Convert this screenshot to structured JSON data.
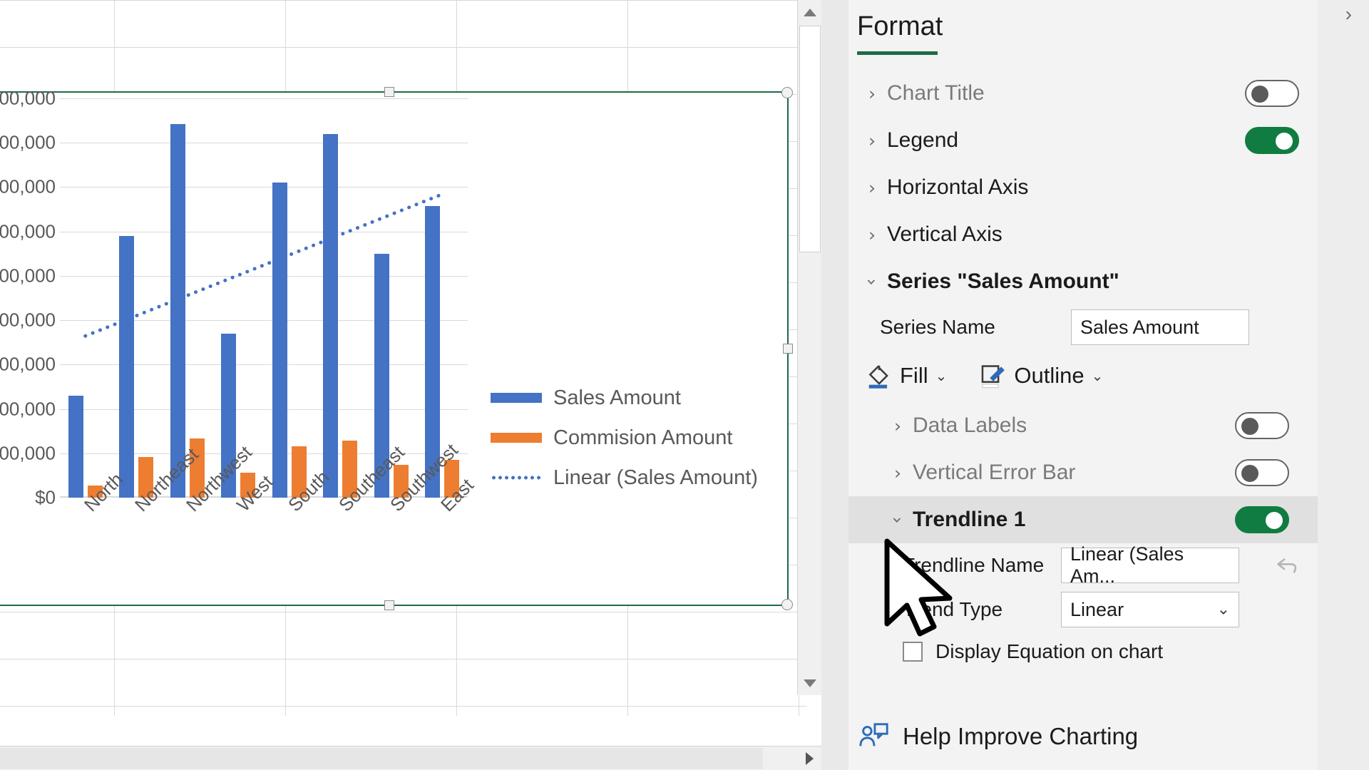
{
  "chart_data": {
    "type": "bar",
    "title": "",
    "xlabel": "",
    "ylabel": "",
    "categories": [
      "North",
      "Northeast",
      "Northwest",
      "West",
      "South",
      "Southeast",
      "Southwest",
      "East"
    ],
    "ytick_labels": [
      "$0",
      "00,000",
      "00,000",
      "00,000",
      "00,000",
      "00,000",
      "00,000",
      "00,000",
      "00,000",
      "00,000"
    ],
    "ylim": [
      0,
      10
    ],
    "grid": true,
    "legend_position": "right",
    "series": [
      {
        "name": "Sales Amount",
        "color": "#4472c4",
        "values": [
          2.55,
          6.55,
          9.35,
          4.1,
          7.9,
          9.1,
          6.1,
          7.3
        ]
      },
      {
        "name": "Commision Amount",
        "color": "#ed7d31",
        "values": [
          0.3,
          1.02,
          1.48,
          0.62,
          1.28,
          1.42,
          0.82,
          0.95
        ]
      }
    ],
    "trendline": {
      "name": "Linear (Sales Amount)",
      "color": "#4472c4",
      "style": "dotted",
      "start": 4.05,
      "end": 7.6
    },
    "legend": [
      {
        "label": "Sales Amount",
        "marker": "bar",
        "color": "#4472c4"
      },
      {
        "label": "Commision Amount",
        "marker": "bar",
        "color": "#ed7d31"
      },
      {
        "label": "Linear (Sales Amount)",
        "marker": "dotted",
        "color": "#4472c4"
      }
    ]
  },
  "pane": {
    "title": "Format",
    "accent_color": "#1e6b45",
    "toggle_on_color": "#107c41",
    "collapse_icon": "chevron-right-icon",
    "sections": [
      {
        "key": "chart_title",
        "label": "Chart Title",
        "muted": true,
        "expanded": false,
        "toggle": "off"
      },
      {
        "key": "legend",
        "label": "Legend",
        "muted": false,
        "expanded": false,
        "toggle": "on"
      },
      {
        "key": "horizontal_axis",
        "label": "Horizontal Axis",
        "muted": false,
        "expanded": false,
        "toggle": null
      },
      {
        "key": "vertical_axis",
        "label": "Vertical Axis",
        "muted": false,
        "expanded": false,
        "toggle": null
      },
      {
        "key": "series",
        "label": "Series \"Sales Amount\"",
        "muted": false,
        "expanded": true,
        "toggle": null
      }
    ],
    "series_section": {
      "series_name_label": "Series Name",
      "series_name_value": "Sales Amount",
      "fill_label": "Fill",
      "outline_label": "Outline",
      "subsections": [
        {
          "key": "data_labels",
          "label": "Data Labels",
          "muted": true,
          "expanded": false,
          "toggle": "off"
        },
        {
          "key": "vertical_error_bar",
          "label": "Vertical Error Bar",
          "muted": true,
          "expanded": false,
          "toggle": "off"
        }
      ],
      "trendline": {
        "label": "Trendline 1",
        "selected": true,
        "expanded": true,
        "toggle": "on",
        "name_label": "Trendline Name",
        "name_value": "Linear (Sales Am...",
        "reset_icon": "undo-icon",
        "type_label": "Trend Type",
        "type_value": "Linear",
        "display_equation_label": "Display Equation on chart",
        "display_equation_checked": false
      }
    },
    "footer": {
      "label": "Help Improve Charting",
      "icon": "feedback-person-icon"
    }
  },
  "scrollbars": {
    "vertical_up_icon": "triangle-up-icon",
    "vertical_down_icon": "triangle-down-icon",
    "horizontal_right_icon": "triangle-right-icon"
  }
}
